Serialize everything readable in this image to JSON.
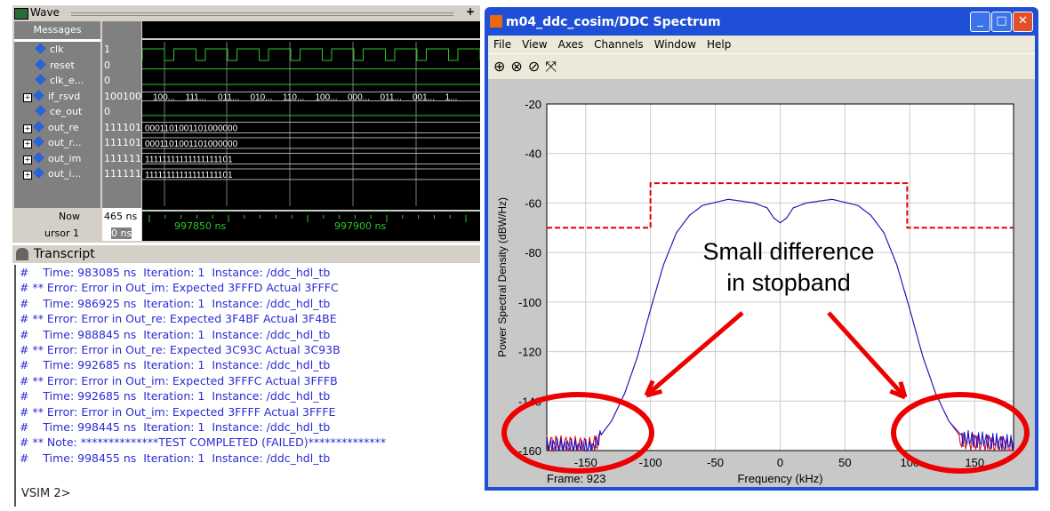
{
  "wave": {
    "title": "Wave",
    "messages_header": "Messages",
    "signals": [
      {
        "name": "clk",
        "value": "1",
        "expand": false
      },
      {
        "name": "reset",
        "value": "0",
        "expand": false
      },
      {
        "name": "clk_e...",
        "value": "0",
        "expand": false
      },
      {
        "name": "if_rsvd",
        "value": "100100(",
        "expand": true
      },
      {
        "name": "ce_out",
        "value": "0",
        "expand": false
      },
      {
        "name": "out_re",
        "value": "111101(",
        "expand": true
      },
      {
        "name": "out_r...",
        "value": "111101(",
        "expand": true
      },
      {
        "name": "out_im",
        "value": "111111",
        "expand": true
      },
      {
        "name": "out_i...",
        "value": "111111",
        "expand": true
      }
    ],
    "bus_labels": {
      "if_rsvd": [
        "100...",
        "111...",
        "011...",
        "010...",
        "110...",
        "100...",
        "000...",
        "011...",
        "001...",
        "1..."
      ],
      "out_re": "0001101001101000000",
      "out_r": "0001101001101000000",
      "out_im": "11111111111111111101",
      "out_i": "11111111111111111101"
    },
    "now_label": "Now",
    "now_value": "465 ns",
    "cursor_label": "ursor 1",
    "cursor_value": "0 ns",
    "time_ticks": [
      "997850 ns",
      "997900 ns"
    ]
  },
  "transcript": {
    "title": "Transcript",
    "lines": [
      "#    Time: 983085 ns  Iteration: 1  Instance: /ddc_hdl_tb",
      "# ** Error: Error in Out_im: Expected 3FFFD Actual 3FFFC",
      "#    Time: 986925 ns  Iteration: 1  Instance: /ddc_hdl_tb",
      "# ** Error: Error in Out_re: Expected 3F4BF Actual 3F4BE",
      "#    Time: 988845 ns  Iteration: 1  Instance: /ddc_hdl_tb",
      "# ** Error: Error in Out_re: Expected 3C93C Actual 3C93B",
      "#    Time: 992685 ns  Iteration: 1  Instance: /ddc_hdl_tb",
      "# ** Error: Error in Out_im: Expected 3FFFC Actual 3FFFB",
      "#    Time: 992685 ns  Iteration: 1  Instance: /ddc_hdl_tb",
      "# ** Error: Error in Out_im: Expected 3FFFF Actual 3FFFE",
      "#    Time: 998445 ns  Iteration: 1  Instance: /ddc_hdl_tb",
      "# ** Note: **************TEST COMPLETED (FAILED)**************",
      "#    Time: 998455 ns  Iteration: 1  Instance: /ddc_hdl_tb"
    ],
    "prompt": "VSIM 2>"
  },
  "figure": {
    "title": "m04_ddc_cosim/DDC Spectrum",
    "menu": [
      "File",
      "View",
      "Axes",
      "Channels",
      "Window",
      "Help"
    ],
    "tools": [
      "zoom-in-icon",
      "zoom-x-icon",
      "zoom-y-icon",
      "autoscale-icon"
    ],
    "frame_label": "Frame: 923",
    "annotation": [
      "Small difference",
      "in stopband"
    ]
  },
  "chart_data": {
    "type": "line",
    "xlabel": "Frequency (kHz)",
    "ylabel": "Power Spectral Density (dBW/Hz)",
    "xlim": [
      -180,
      180
    ],
    "ylim": [
      -160,
      -20
    ],
    "xticks": [
      -150,
      -100,
      -50,
      0,
      50,
      100,
      150
    ],
    "yticks": [
      -20,
      -40,
      -60,
      -80,
      -100,
      -120,
      -140,
      -160
    ],
    "grid": true,
    "mask": {
      "color": "#e00000",
      "style": "dashed",
      "x": [
        -180,
        -100,
        -100,
        98,
        98,
        180
      ],
      "y": [
        -70,
        -70,
        -52,
        -52,
        -70,
        -70
      ]
    },
    "series": [
      {
        "color": "#e00000",
        "x": [
          -180,
          -145,
          -140,
          -130,
          -120,
          -110,
          -100,
          -90,
          -80,
          -70,
          -60,
          -40,
          -20,
          -10,
          -5,
          0,
          5,
          10,
          20,
          40,
          60,
          70,
          80,
          90,
          100,
          110,
          120,
          130,
          140,
          180
        ],
        "y": [
          -156,
          -157,
          -155,
          -148,
          -137,
          -122,
          -103,
          -85,
          -72,
          -65,
          -61,
          -58.5,
          -60,
          -62,
          -66,
          -68,
          -66,
          -62,
          -60,
          -58.5,
          -61,
          -65,
          -72,
          -85,
          -103,
          -122,
          -137,
          -148,
          -155,
          -157
        ]
      },
      {
        "color": "#1010d0",
        "x": [
          -180,
          -145,
          -140,
          -130,
          -120,
          -110,
          -100,
          -90,
          -80,
          -70,
          -60,
          -40,
          -20,
          -10,
          -5,
          0,
          5,
          10,
          20,
          40,
          60,
          70,
          80,
          90,
          100,
          110,
          120,
          130,
          140,
          180
        ],
        "y": [
          -157,
          -158,
          -155,
          -148,
          -137,
          -122,
          -103,
          -85,
          -72,
          -65,
          -61,
          -58.5,
          -60,
          -62,
          -66,
          -68,
          -66,
          -62,
          -60,
          -58.5,
          -61,
          -65,
          -72,
          -85,
          -103,
          -122,
          -137,
          -148,
          -154,
          -156
        ]
      }
    ]
  },
  "colors": {
    "wave_green": "#28c828",
    "transcript_text": "#2b2bd6",
    "annotation_red": "#ee0000"
  }
}
